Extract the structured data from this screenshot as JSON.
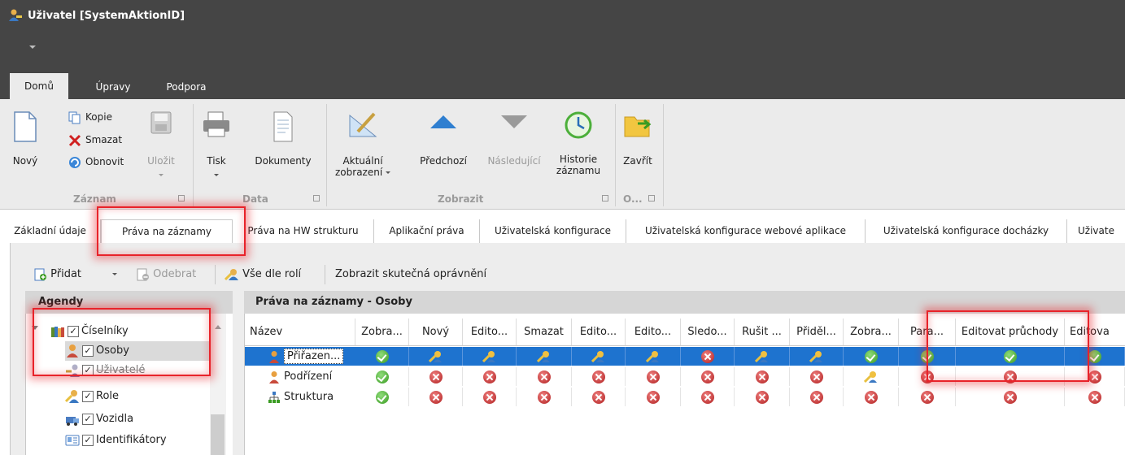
{
  "window": {
    "title": "Uživatel [SystemAktionID]",
    "icon": "user-key-icon"
  },
  "ribbon_tabs": [
    "Domů",
    "Úpravy",
    "Podpora"
  ],
  "ribbon": {
    "novy": "Nový",
    "kopie": "Kopie",
    "smazat": "Smazat",
    "obnovit": "Obnovit",
    "ulozit": "Uložit",
    "group_zaznam": "Záznam",
    "tisk": "Tisk",
    "dokumenty": "Dokumenty",
    "group_data": "Data",
    "aktualni_1": "Aktuální",
    "aktualni_2": "zobrazení",
    "predchozi": "Předchozí",
    "nasledujici": "Následující",
    "historie_1": "Historie",
    "historie_2": "záznamu",
    "group_zobrazit": "Zobrazit",
    "zavrit": "Zavřít",
    "group_o": "O..."
  },
  "main_tabs": [
    "Základní údaje",
    "Práva na záznamy",
    "Práva na HW strukturu",
    "Aplikační práva",
    "Uživatelská konfigurace",
    "Uživatelská konfigurace webové aplikace",
    "Uživatelská konfigurace docházky",
    "Uživate"
  ],
  "toolbar": {
    "pridat": "Přidat",
    "odebrat": "Odebrat",
    "vse_dle_roli": "Vše dle rolí",
    "zobrazit_skutecna": "Zobrazit skutečná oprávnění"
  },
  "agendy": {
    "header": "Agendy",
    "items": [
      {
        "label": "Číselníky",
        "checked": true,
        "icon": "books-icon"
      },
      {
        "label": "Osoby",
        "checked": true,
        "icon": "person-icon"
      },
      {
        "label": "Uživatelé",
        "checked": true,
        "icon": "users-key-icon"
      },
      {
        "label": "Role",
        "checked": true,
        "icon": "role-key-icon"
      },
      {
        "label": "Vozidla",
        "checked": true,
        "icon": "vehicle-icon"
      },
      {
        "label": "Identifikátory",
        "checked": true,
        "icon": "id-card-icon"
      }
    ]
  },
  "grid": {
    "header": "Práva na záznamy - Osoby",
    "columns": [
      "Název",
      "Zobra...",
      "Nový",
      "Edito...",
      "Smazat",
      "Edito...",
      "Edito...",
      "Sledo...",
      "Rušit ...",
      "Přiděl...",
      "Zobra...",
      "Para...",
      "Editovat průchody",
      "Editova"
    ],
    "rows": [
      {
        "name": "Přiřazen...",
        "icon": "person-icon",
        "values": [
          "ok",
          "key",
          "key",
          "key",
          "key",
          "key",
          "no",
          "key",
          "key",
          "ok",
          "ok",
          "ok",
          "ok"
        ]
      },
      {
        "name": "Podřízení",
        "icon": "person-icon",
        "values": [
          "ok",
          "no",
          "no",
          "no",
          "no",
          "no",
          "no",
          "no",
          "no",
          "key",
          "no",
          "no",
          "no"
        ]
      },
      {
        "name": "Struktura",
        "icon": "hierarchy-icon",
        "values": [
          "ok",
          "no",
          "no",
          "no",
          "no",
          "no",
          "no",
          "no",
          "no",
          "no",
          "no",
          "no",
          "no"
        ]
      }
    ]
  },
  "colors": {
    "title_bg": "#454545",
    "ribbon_bg": "#ebebeb",
    "selection": "#1e73cf",
    "highlight": "#e8232a"
  }
}
